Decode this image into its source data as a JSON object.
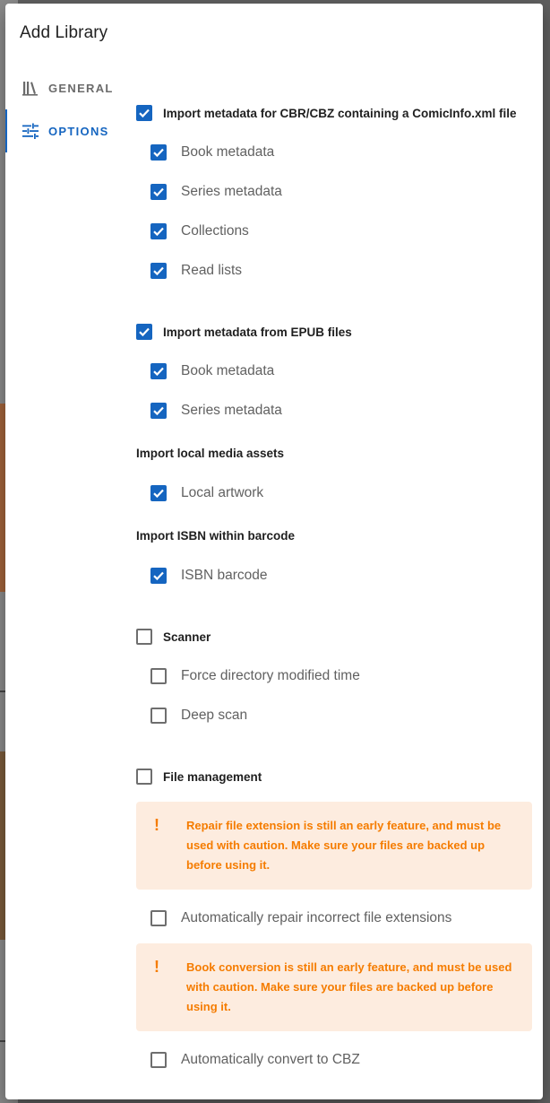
{
  "dialog": {
    "title": "Add Library"
  },
  "tabs": [
    {
      "label": "GENERAL",
      "icon": "library-books-icon",
      "active": false
    },
    {
      "label": "OPTIONS",
      "icon": "tune-icon",
      "active": true
    }
  ],
  "options": {
    "comicinfo": {
      "label": "Import metadata for CBR/CBZ containing a ComicInfo.xml file",
      "checked": true,
      "items": [
        {
          "label": "Book metadata",
          "checked": true
        },
        {
          "label": "Series metadata",
          "checked": true
        },
        {
          "label": "Collections",
          "checked": true
        },
        {
          "label": "Read lists",
          "checked": true
        }
      ]
    },
    "epub": {
      "label": "Import metadata from EPUB files",
      "checked": true,
      "items": [
        {
          "label": "Book metadata",
          "checked": true
        },
        {
          "label": "Series metadata",
          "checked": true
        }
      ]
    },
    "local_media": {
      "heading": "Import local media assets",
      "items": [
        {
          "label": "Local artwork",
          "checked": true
        }
      ]
    },
    "isbn": {
      "heading": "Import ISBN within barcode",
      "items": [
        {
          "label": "ISBN barcode",
          "checked": true
        }
      ]
    },
    "scanner": {
      "label": "Scanner",
      "checked": false,
      "items": [
        {
          "label": "Force directory modified time",
          "checked": false
        },
        {
          "label": "Deep scan",
          "checked": false
        }
      ]
    },
    "file_management": {
      "label": "File management",
      "checked": false,
      "repair_alert": "Repair file extension is still an early feature, and must be used with caution. Make sure your files are backed up before using it.",
      "repair_option": {
        "label": "Automatically repair incorrect file extensions",
        "checked": false
      },
      "convert_alert": "Book conversion is still an early feature, and must be used with caution. Make sure your files are backed up before using it.",
      "convert_option": {
        "label": "Automatically convert to CBZ",
        "checked": false
      },
      "alert_icon": "!"
    }
  },
  "colors": {
    "accent": "#1565c0",
    "warning_text": "#f57c00",
    "warning_bg": "#fdecdf"
  }
}
